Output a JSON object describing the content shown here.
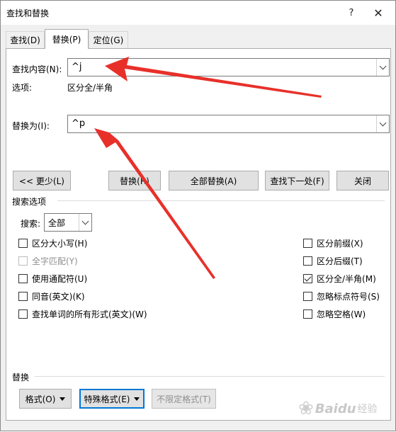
{
  "window": {
    "title": "查找和替换",
    "help": "?",
    "close": "✕"
  },
  "tabs": [
    {
      "label": "查找(D)"
    },
    {
      "label": "替换(P)"
    },
    {
      "label": "定位(G)"
    }
  ],
  "find": {
    "label": "查找内容(N):",
    "value": "^j"
  },
  "options": {
    "label": "选项:",
    "value": "区分全/半角"
  },
  "replace": {
    "label": "替换为(I):",
    "value": "^p"
  },
  "buttons": {
    "less": "<< 更少(L)",
    "replace": "替换(R)",
    "replace_all": "全部替换(A)",
    "find_next": "查找下一处(F)",
    "close": "关闭"
  },
  "search_options": {
    "title": "搜索选项",
    "search_label": "搜索:",
    "search_value": "全部"
  },
  "checkboxes_left": [
    {
      "label": "区分大小写(H)",
      "checked": false,
      "disabled": false
    },
    {
      "label": "全字匹配(Y)",
      "checked": false,
      "disabled": true
    },
    {
      "label": "使用通配符(U)",
      "checked": false,
      "disabled": false
    },
    {
      "label": "同音(英文)(K)",
      "checked": false,
      "disabled": false
    },
    {
      "label": "查找单词的所有形式(英文)(W)",
      "checked": false,
      "disabled": false
    }
  ],
  "checkboxes_right": [
    {
      "label": "区分前缀(X)",
      "checked": false,
      "disabled": false
    },
    {
      "label": "区分后缀(T)",
      "checked": false,
      "disabled": false
    },
    {
      "label": "区分全/半角(M)",
      "checked": true,
      "disabled": false
    },
    {
      "label": "忽略标点符号(S)",
      "checked": false,
      "disabled": false
    },
    {
      "label": "忽略空格(W)",
      "checked": false,
      "disabled": false
    }
  ],
  "replace_section": {
    "title": "替换",
    "format": "格式(O)",
    "special": "特殊格式(E)",
    "no_format": "不限定格式(T)"
  },
  "watermark": {
    "text": "Baidu",
    "suffix": "经验"
  },
  "colors": {
    "arrow": "#e8302a",
    "accent": "#0078d7"
  }
}
